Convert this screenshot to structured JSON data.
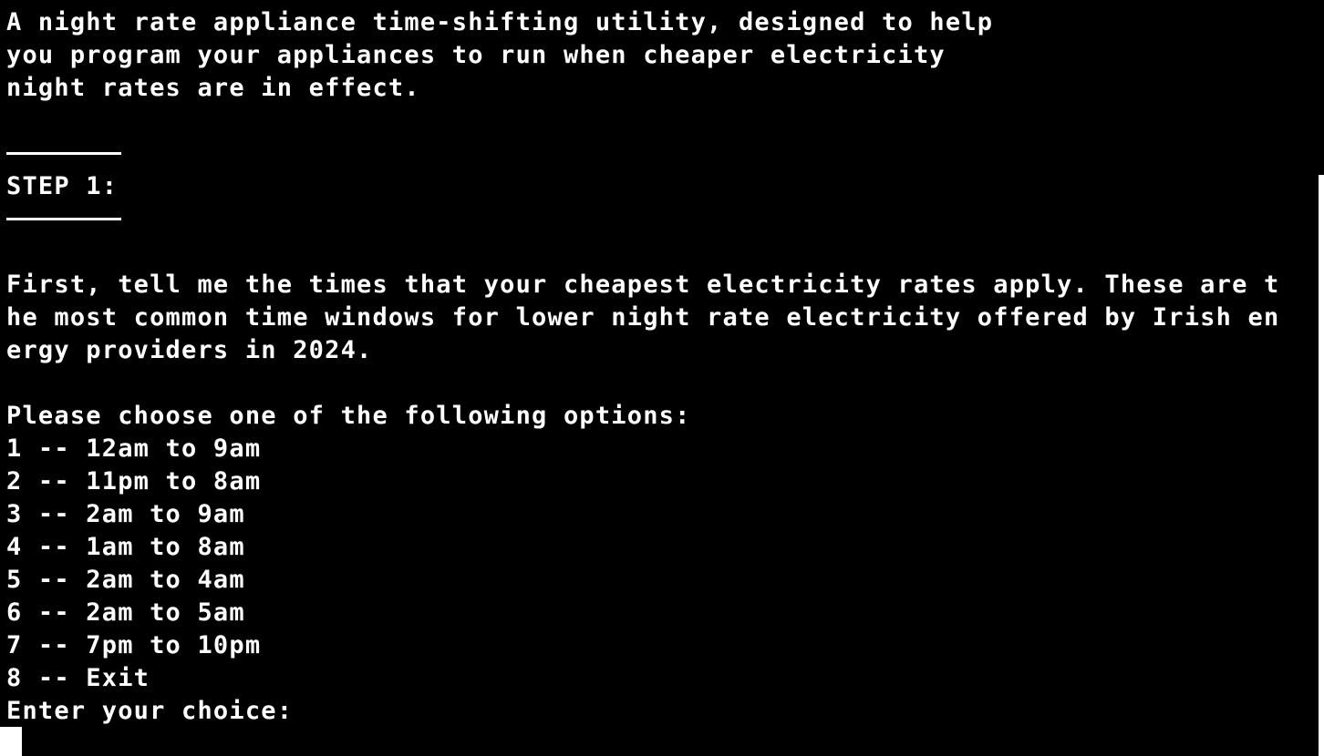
{
  "terminal": {
    "intro": [
      "A night rate appliance time-shifting utility, designed to help",
      "you program your appliances to run when cheaper electricity",
      "night rates are in effect."
    ],
    "step_heading": "STEP 1:",
    "description": [
      "First, tell me the times that your cheapest electricity rates apply. These are t",
      "he most common time windows for lower night rate electricity offered by Irish en",
      "ergy providers in 2024."
    ],
    "options_prompt": "Please choose one of the following options:",
    "options": [
      "1 -- 12am to 9am",
      "2 -- 11pm to 8am",
      "3 -- 2am to 9am",
      "4 -- 1am to 8am",
      "5 -- 2am to 4am",
      "6 -- 2am to 5am",
      "7 -- 7pm to 10pm",
      "8 -- Exit"
    ],
    "input_prompt": "Enter your choice:"
  },
  "colors": {
    "background": "#000000",
    "text": "#ffffff"
  }
}
